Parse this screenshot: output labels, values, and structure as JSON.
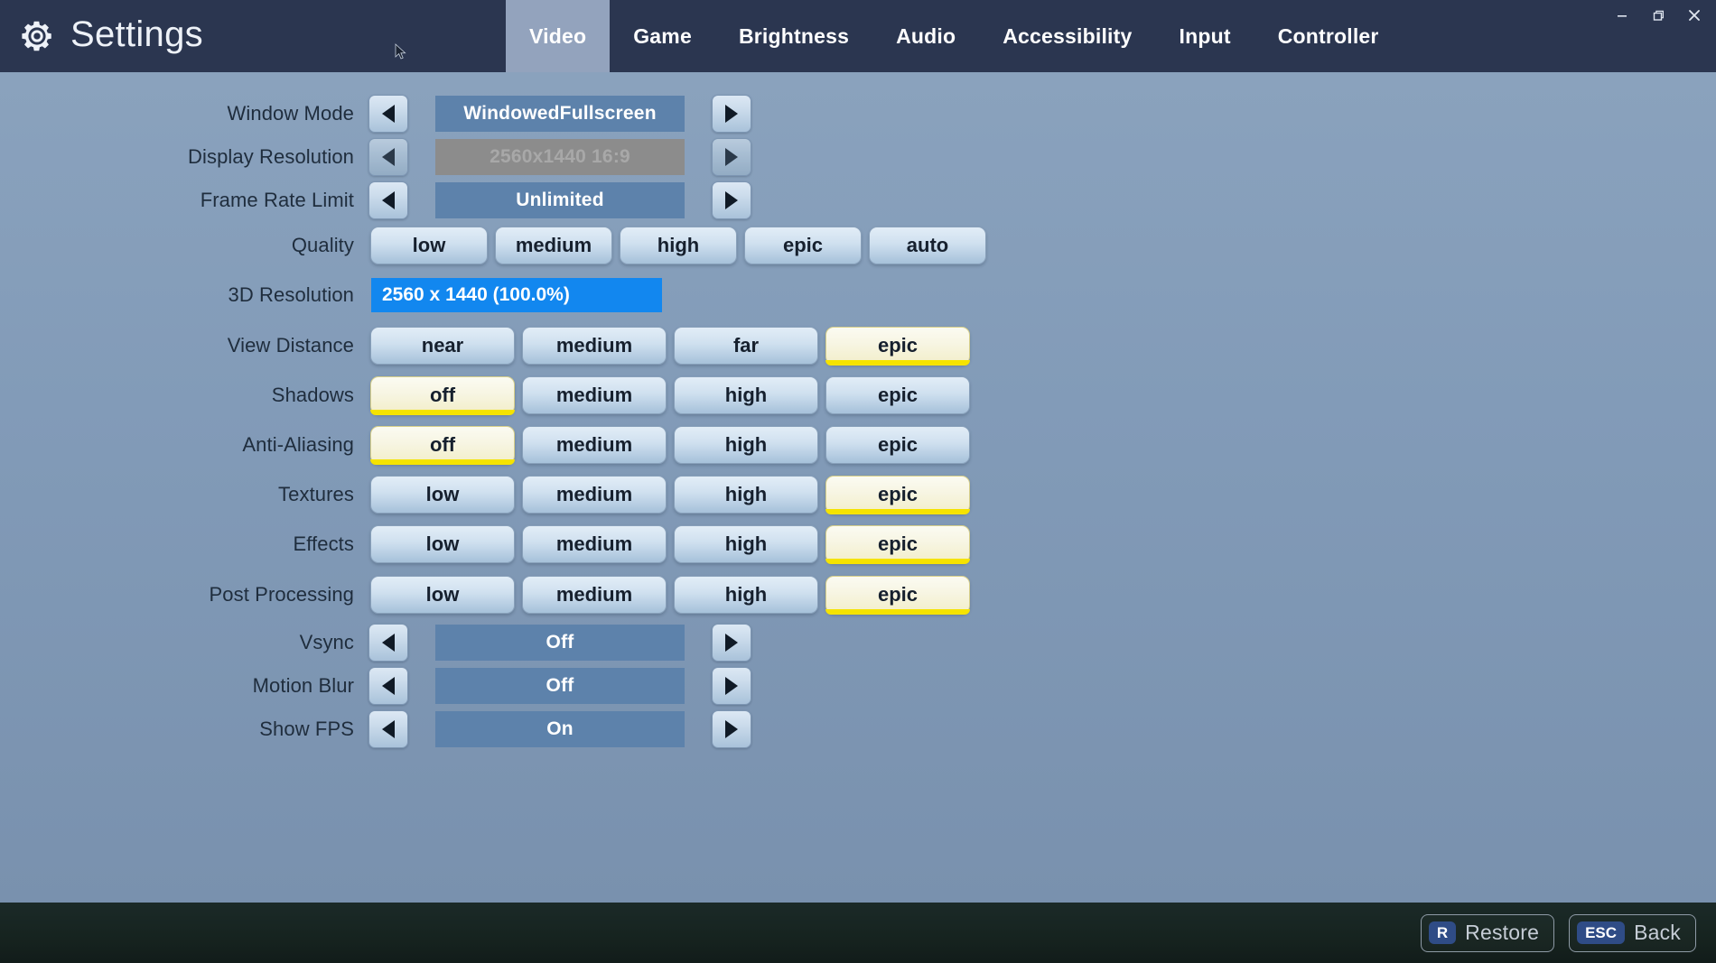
{
  "window": {
    "title": "Settings",
    "gear_icon": "gear-icon",
    "controls": [
      {
        "name": "minimize",
        "glyph": "minimize-icon"
      },
      {
        "name": "restore",
        "glyph": "restore-icon"
      },
      {
        "name": "close",
        "glyph": "close-icon"
      }
    ]
  },
  "tabs": [
    {
      "label": "Video",
      "active": true
    },
    {
      "label": "Game",
      "active": false
    },
    {
      "label": "Brightness",
      "active": false
    },
    {
      "label": "Audio",
      "active": false
    },
    {
      "label": "Accessibility",
      "active": false
    },
    {
      "label": "Input",
      "active": false
    },
    {
      "label": "Controller",
      "active": false
    }
  ],
  "settings": {
    "window_mode": {
      "label": "Window Mode",
      "value": "WindowedFullscreen",
      "disabled": false
    },
    "display_resolution": {
      "label": "Display Resolution",
      "value": "2560x1440 16:9",
      "disabled": true
    },
    "frame_rate_limit": {
      "label": "Frame Rate Limit",
      "value": "Unlimited",
      "disabled": false
    },
    "quality": {
      "label": "Quality",
      "options": [
        "low",
        "medium",
        "high",
        "epic",
        "auto"
      ],
      "selected": -1
    },
    "resolution_3d": {
      "label": "3D Resolution",
      "value": "2560 x 1440 (100.0%)"
    },
    "view_distance": {
      "label": "View Distance",
      "options": [
        "near",
        "medium",
        "far",
        "epic"
      ],
      "selected": 3
    },
    "shadows": {
      "label": "Shadows",
      "options": [
        "off",
        "medium",
        "high",
        "epic"
      ],
      "selected": 0
    },
    "anti_aliasing": {
      "label": "Anti-Aliasing",
      "options": [
        "off",
        "medium",
        "high",
        "epic"
      ],
      "selected": 0
    },
    "textures": {
      "label": "Textures",
      "options": [
        "low",
        "medium",
        "high",
        "epic"
      ],
      "selected": 3
    },
    "effects": {
      "label": "Effects",
      "options": [
        "low",
        "medium",
        "high",
        "epic"
      ],
      "selected": 3
    },
    "post_processing": {
      "label": "Post Processing",
      "options": [
        "low",
        "medium",
        "high",
        "epic"
      ],
      "selected": 3
    },
    "vsync": {
      "label": "Vsync",
      "value": "Off",
      "disabled": false
    },
    "motion_blur": {
      "label": "Motion Blur",
      "value": "Off",
      "disabled": false
    },
    "show_fps": {
      "label": "Show FPS",
      "value": "On",
      "disabled": false
    }
  },
  "footer": {
    "buttons": [
      {
        "key": "R",
        "label": "Restore"
      },
      {
        "key": "ESC",
        "label": "Back"
      }
    ]
  },
  "colors": {
    "titlebar": "#2b3650",
    "tab_active_bg": "#93a3bd",
    "panel_bg": "#829bb8",
    "value_pill": "#5d82ab",
    "value_pill_disabled": "#8c8c8c",
    "slider": "#1287ef",
    "selected_underline": "#f5e300",
    "footer_bg": "#16231f",
    "keycap": "#2f4c86"
  }
}
